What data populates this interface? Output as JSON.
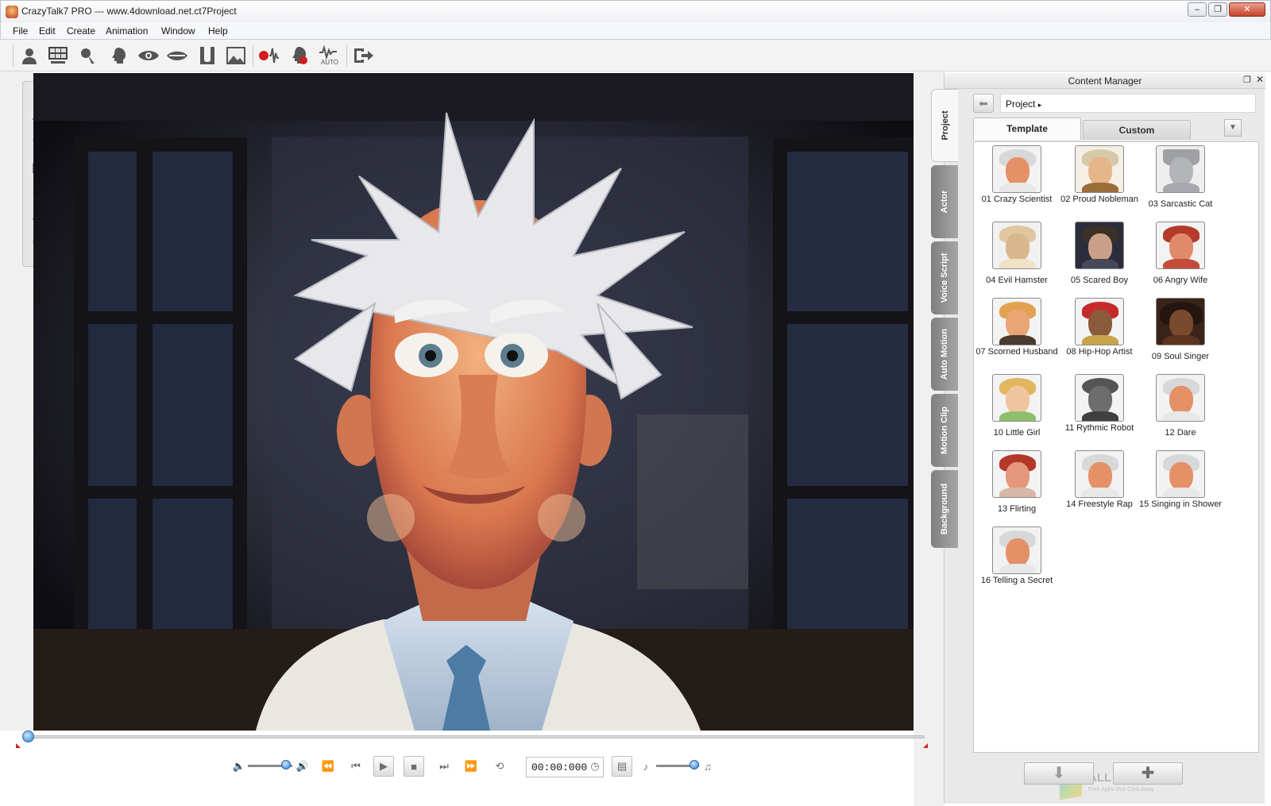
{
  "window": {
    "title": "CrazyTalk7 PRO --- www.4download.net.ct7Project",
    "buttons": [
      "minimize",
      "restore",
      "close"
    ]
  },
  "menu": [
    "File",
    "Edit",
    "Create",
    "Animation",
    "Window",
    "Help"
  ],
  "toolbar": {
    "icons": [
      "actor-icon",
      "image-grid-icon",
      "face-fitting-icon",
      "head-icon",
      "eye-icon",
      "mouth-icon",
      "face-profile-icon",
      "background-image-icon",
      "record-audio-icon",
      "record-voice-icon",
      "auto-motion-icon",
      "export-icon"
    ],
    "auto_label": "AUTO"
  },
  "view_tools": [
    "home-icon",
    "move-icon",
    "rotate-icon",
    "zoom-icon",
    "fit-icon",
    "undo-icon",
    "redo-icon"
  ],
  "content_manager": {
    "title": "Content Manager",
    "side_tabs": [
      "Project",
      "Actor",
      "Voice Script",
      "Auto Motion",
      "Motion Clip",
      "Background"
    ],
    "path": "Project",
    "tabs": {
      "template": "Template",
      "custom": "Custom"
    },
    "items": [
      {
        "label": "01 Crazy Scientist"
      },
      {
        "label": "02 Proud Nobleman"
      },
      {
        "label": "03 Sarcastic Cat"
      },
      {
        "label": "04 Evil Hamster"
      },
      {
        "label": "05 Scared Boy"
      },
      {
        "label": "06 Angry Wife"
      },
      {
        "label": "07 Scorned Husband"
      },
      {
        "label": "08 Hip-Hop Artist"
      },
      {
        "label": "09 Soul Singer"
      },
      {
        "label": "10 Little Girl"
      },
      {
        "label": "11 Rythmic Robot"
      },
      {
        "label": "12 Dare"
      },
      {
        "label": "13 Flirting"
      },
      {
        "label": "14 Freestyle Rap"
      },
      {
        "label": "15 Singing in Shower"
      },
      {
        "label": "16 Telling a Secret"
      }
    ],
    "watermark": {
      "title": "ALL PC World",
      "subtitle": "Free Apps One Click Away"
    }
  },
  "transport": {
    "timecode": "00:00:000",
    "progress": 0
  }
}
